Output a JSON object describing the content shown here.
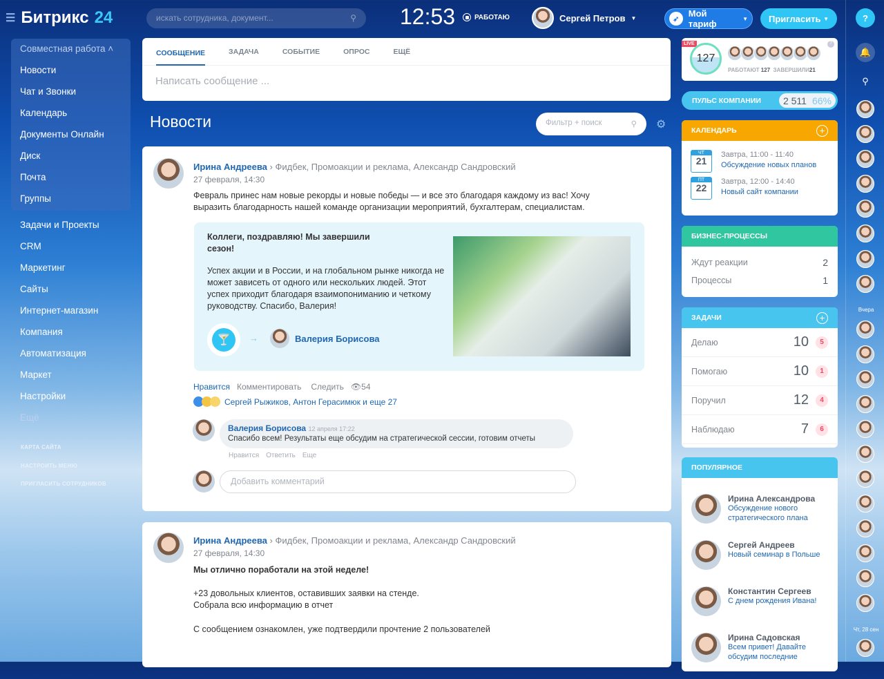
{
  "header": {
    "logo_text": "Битрикс",
    "logo_num": "24",
    "search_placeholder": "искать сотрудника, документ...",
    "clock": "12:53",
    "status": "РАБОТАЮ",
    "user_name": "Сергей Петров",
    "tariff": "Мой тариф",
    "invite": "Пригласить"
  },
  "sidebar": {
    "group_title": "Совместная работа",
    "group_items": [
      "Новости",
      "Чат и Звонки",
      "Календарь",
      "Документы Онлайн",
      "Диск",
      "Почта",
      "Группы"
    ],
    "items": [
      "Задачи и Проекты",
      "CRM",
      "Маркетинг",
      "Сайты",
      "Интернет-магазин",
      "Компания",
      "Автоматизация",
      "Маркет",
      "Настройки"
    ],
    "more": "Ещё",
    "links": [
      "КАРТА САЙТА",
      "НАСТРОИТЬ МЕНЮ",
      "ПРИГЛАСИТЬ СОТРУДНИКОВ"
    ]
  },
  "composer": {
    "tabs": [
      "СООБЩЕНИЕ",
      "ЗАДАЧА",
      "СОБЫТИЕ",
      "ОПРОС",
      "ЕЩЁ"
    ],
    "placeholder": "Написать сообщение ..."
  },
  "feed": {
    "title": "Новости",
    "filter_placeholder": "Фильтр + поиск",
    "post1": {
      "author": "Ирина Андреева",
      "recipients": "Фидбек, Промоакции и реклама, Александр Сандровский",
      "date": "27 февраля, 14:30",
      "text": "Февраль принес нам новые рекорды и новые победы — и все это благодаря каждому из вас! Хочу выразить благодарность нашей команде организации мероприятий, бухгалтерам, специалистам.",
      "quote_title": "Коллеги, поздравляю! Мы завершили сезон!",
      "quote_text": "Успех акции и в России, и на глобальном рынке никогда не может зависеть от одного или нескольких людей. Этот успех приходит благодаря взаимопониманию и четкому руководству. Спасибо, Валерия!",
      "quote_to": "Валерия Борисова",
      "actions": {
        "like": "Нравится",
        "comment": "Комментировать",
        "follow": "Следить",
        "views": "54"
      },
      "likers": "Сергей Рыжиков, Антон Герасимюк и еще 27",
      "comment": {
        "author": "Валерия Борисова",
        "date": "12 апреля 17:22",
        "text": "Спасибо всем! Результаты еще обсудим на стратегической сессии, готовим отчеты",
        "like": "Нравится",
        "reply": "Ответить",
        "more": "Еще"
      },
      "comment_placeholder": "Добавить комментарий"
    },
    "post2": {
      "author": "Ирина Андреева",
      "recipients": "Фидбек, Промоакции и реклама, Александр Сандровский",
      "date": "27 февраля, 14:30",
      "title": "Мы отлично поработали на этой неделе!",
      "line1": "+23 довольных клиентов, оставивших заявки на стенде.",
      "line2": "Собрала всю информацию в отчет",
      "line3": "С сообщением ознакомлен, уже подтвердили прочтение 2 пользователей"
    }
  },
  "right": {
    "live": "LIVE",
    "online": "127",
    "working_label": "РАБОТАЮТ",
    "working": "127",
    "done_label": "ЗАВЕРШИЛИ",
    "done": "21",
    "pulse_label": "ПУЛЬС КОМПАНИИ",
    "pulse_value": "2 511",
    "pulse_pct": "66%",
    "calendar": {
      "title": "КАЛЕНДАРЬ",
      "events": [
        {
          "dow": "ЧТ",
          "day": "21",
          "time": "Завтра, 11:00 - 11:40",
          "title": "Обсуждение новых планов"
        },
        {
          "dow": "ПТ",
          "day": "22",
          "time": "Завтра, 12:00 - 14:40",
          "title": "Новый сайт компании"
        }
      ]
    },
    "bp": {
      "title": "БИЗНЕС-ПРОЦЕССЫ",
      "rows": [
        {
          "label": "Ждут реакции",
          "value": "2"
        },
        {
          "label": "Процессы",
          "value": "1"
        }
      ]
    },
    "tasks": {
      "title": "ЗАДАЧИ",
      "rows": [
        {
          "label": "Делаю",
          "value": "10",
          "badge": "5"
        },
        {
          "label": "Помогаю",
          "value": "10",
          "badge": "1"
        },
        {
          "label": "Поручил",
          "value": "12",
          "badge": "4"
        },
        {
          "label": "Наблюдаю",
          "value": "7",
          "badge": "6"
        }
      ]
    },
    "popular": {
      "title": "ПОПУЛЯРНОЕ",
      "items": [
        {
          "name": "Ирина Александрова",
          "text": "Обсуждение нового стратегического плана"
        },
        {
          "name": "Сергей Андреев",
          "text": "Новый семинар в Польше"
        },
        {
          "name": "Константин Сергеев",
          "text": "С днем рождения Ивана!"
        },
        {
          "name": "Ирина Садовская",
          "text": "Всем привет! Давайте обсудим последние"
        }
      ]
    }
  },
  "strip": {
    "yesterday": "Вчера",
    "date": "Чт, 28 сен"
  },
  "colors": {
    "orange": "#f7a700",
    "green": "#2fc6a0",
    "cyan": "#47c5ee",
    "accent": "#2067b0"
  }
}
